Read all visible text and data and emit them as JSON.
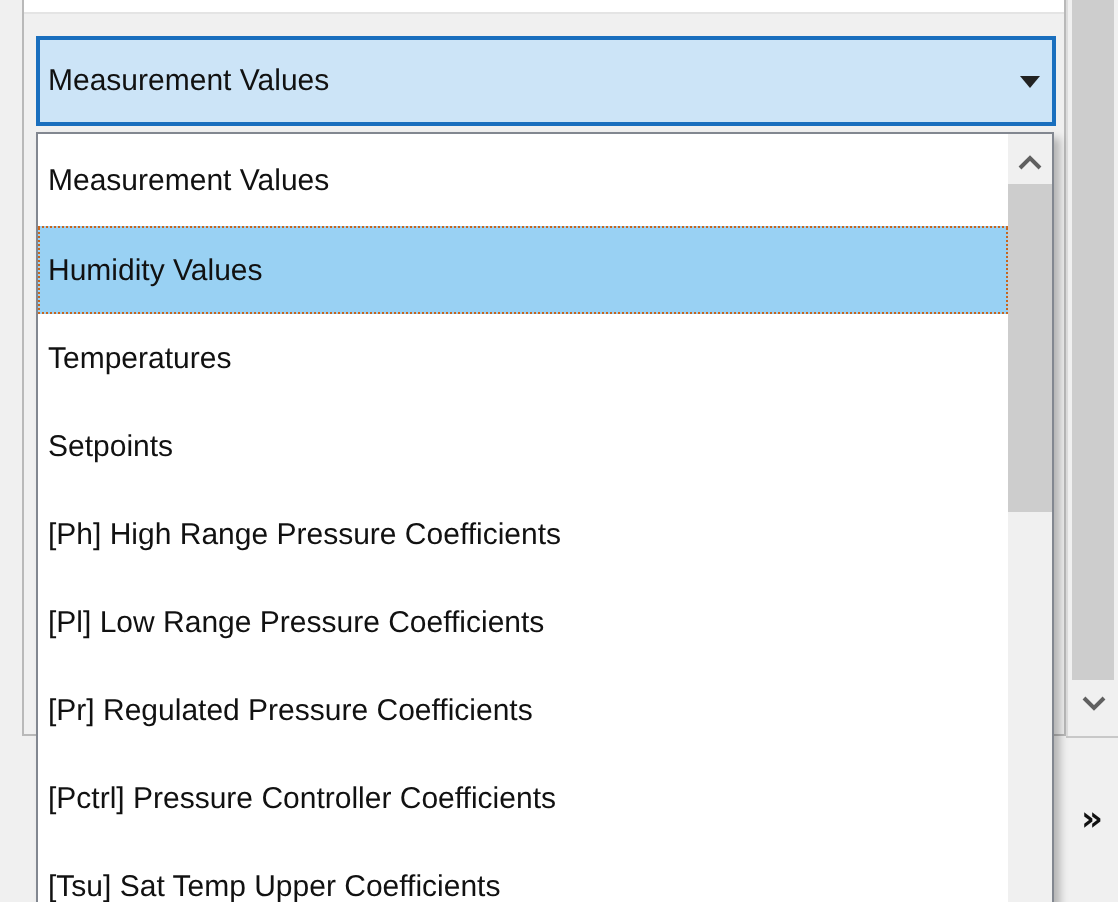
{
  "combobox": {
    "value": "Measurement Values",
    "expanded": true
  },
  "options": [
    {
      "label": "Measurement Values",
      "selected": false
    },
    {
      "label": "Humidity Values",
      "selected": true
    },
    {
      "label": "Temperatures",
      "selected": false
    },
    {
      "label": "Setpoints",
      "selected": false
    },
    {
      "label": "[Ph] High Range Pressure Coefficients",
      "selected": false
    },
    {
      "label": "[Pl] Low Range Pressure Coefficients",
      "selected": false
    },
    {
      "label": "[Pr] Regulated Pressure Coefficients",
      "selected": false
    },
    {
      "label": "[Pctrl] Pressure Controller Coefficients",
      "selected": false
    },
    {
      "label": "[Tsu] Sat Temp Upper Coefficients",
      "selected": false
    }
  ],
  "toolbar": {
    "overflow_button": "»"
  }
}
